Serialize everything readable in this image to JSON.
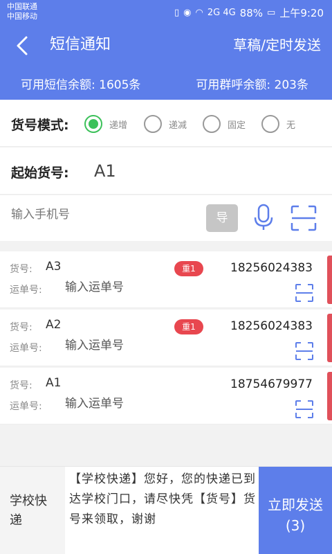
{
  "status_bar": {
    "carrier1": "中国联通",
    "carrier2": "中国移动",
    "signal_text": "2G 4G",
    "battery": "88%",
    "time": "上午9:20"
  },
  "header": {
    "title": "短信通知",
    "action": "草稿/定时发送"
  },
  "quota": {
    "sms": "可用短信余额: 1605条",
    "call": "可用群呼余额: 203条"
  },
  "mode": {
    "label": "货号模式:",
    "options": [
      "递增",
      "递减",
      "固定",
      "无"
    ],
    "selected": "递增"
  },
  "start": {
    "label": "起始货号:",
    "value": "A1"
  },
  "phone_entry": {
    "placeholder": "输入手机号",
    "import_label": "导"
  },
  "items_labels": {
    "code": "货号:",
    "waybill": "运单号:",
    "waybill_placeholder": "输入运单号"
  },
  "items": [
    {
      "code": "A3",
      "badge": "重1",
      "phone": "18256024383"
    },
    {
      "code": "A2",
      "badge": "重1",
      "phone": "18256024383"
    },
    {
      "code": "A1",
      "badge": "",
      "phone": "18754679977"
    }
  ],
  "bottom": {
    "template_name": "学校快递",
    "message": "【学校快递】您好，您的快递已到达学校门口，请尽快凭【货号】货号来领取，谢谢",
    "send_label": "立即发送",
    "send_count": "(3)"
  },
  "colors": {
    "primary": "#5d7eea",
    "selected_radio": "#3cc15a",
    "badge": "#e8474f",
    "scan_icon": "#5d7eea"
  }
}
